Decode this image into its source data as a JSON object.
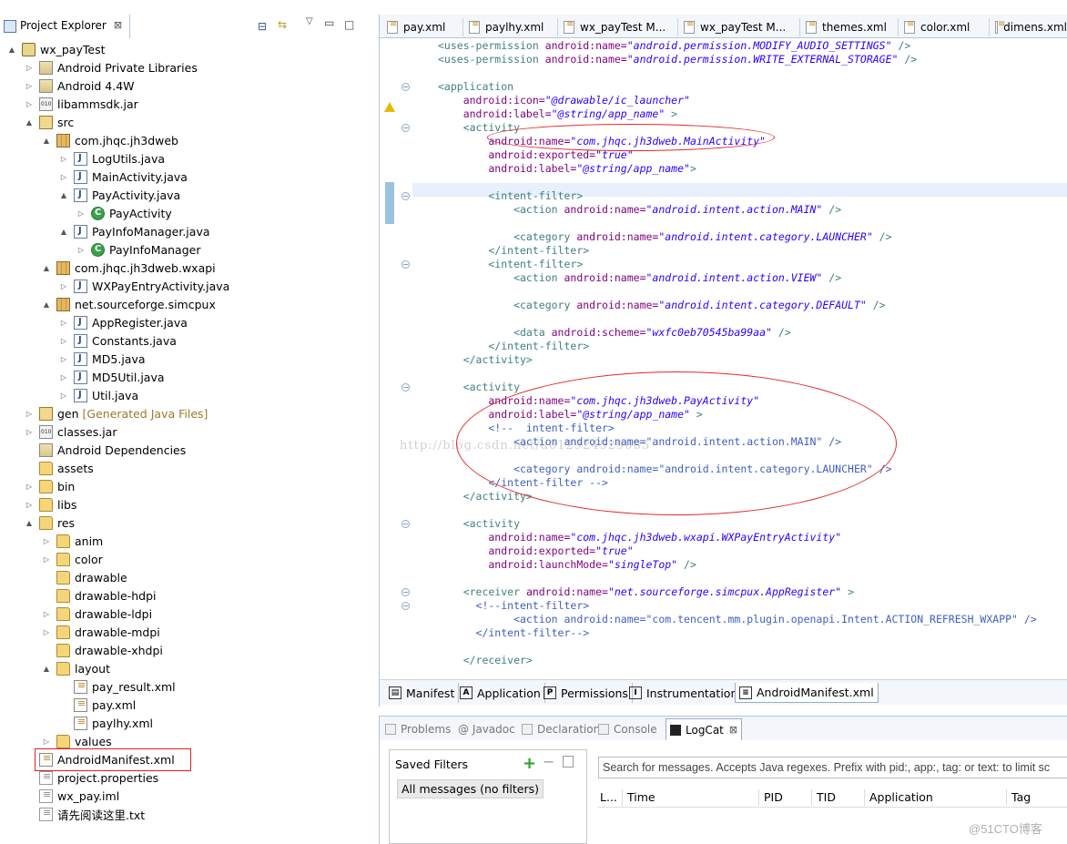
{
  "project_explorer": {
    "tab_title": "Project Explorer",
    "close_glyph": "⊠",
    "tree": [
      {
        "label": "wx_payTest",
        "icon": "project-icon",
        "arrow": "▲",
        "ic": "proj",
        "indent": 0
      },
      {
        "label": "Android Private Libraries",
        "icon": "library-icon",
        "arrow": "▷",
        "ic": "lib",
        "indent": 1
      },
      {
        "label": "Android 4.4W",
        "icon": "library-icon",
        "arrow": "▷",
        "ic": "lib",
        "indent": 1
      },
      {
        "label": "libammsdk.jar",
        "icon": "jar-icon",
        "arrow": "▷",
        "ic": "jar",
        "indent": 1
      },
      {
        "label": "src",
        "icon": "source-folder-icon",
        "arrow": "▲",
        "ic": "src",
        "indent": 1
      },
      {
        "label": "com.jhqc.jh3dweb",
        "icon": "package-icon",
        "arrow": "▲",
        "ic": "pkg",
        "indent": 2
      },
      {
        "label": "LogUtils.java",
        "icon": "java-file-icon",
        "arrow": "▷",
        "ic": "java",
        "indent": 3
      },
      {
        "label": "MainActivity.java",
        "icon": "java-file-icon",
        "arrow": "▷",
        "ic": "java",
        "indent": 3
      },
      {
        "label": "PayActivity.java",
        "icon": "java-file-icon",
        "arrow": "▲",
        "ic": "java",
        "indent": 3
      },
      {
        "label": "PayActivity",
        "icon": "class-icon",
        "arrow": "▷",
        "ic": "cls",
        "indent": 4
      },
      {
        "label": "PayInfoManager.java",
        "icon": "java-file-icon",
        "arrow": "▲",
        "ic": "java",
        "indent": 3
      },
      {
        "label": "PayInfoManager",
        "icon": "class-icon",
        "arrow": "▷",
        "ic": "cls",
        "indent": 4
      },
      {
        "label": "com.jhqc.jh3dweb.wxapi",
        "icon": "package-icon",
        "arrow": "▲",
        "ic": "pkg",
        "indent": 2
      },
      {
        "label": "WXPayEntryActivity.java",
        "icon": "java-file-icon",
        "arrow": "▷",
        "ic": "java",
        "indent": 3
      },
      {
        "label": "net.sourceforge.simcpux",
        "icon": "package-icon",
        "arrow": "▲",
        "ic": "pkg",
        "indent": 2
      },
      {
        "label": "AppRegister.java",
        "icon": "java-file-icon",
        "arrow": "▷",
        "ic": "java",
        "indent": 3
      },
      {
        "label": "Constants.java",
        "icon": "java-file-icon",
        "arrow": "▷",
        "ic": "java",
        "indent": 3
      },
      {
        "label": "MD5.java",
        "icon": "java-file-icon",
        "arrow": "▷",
        "ic": "java",
        "indent": 3
      },
      {
        "label": "MD5Util.java",
        "icon": "java-file-icon",
        "arrow": "▷",
        "ic": "java",
        "indent": 3
      },
      {
        "label": "Util.java",
        "icon": "java-file-icon",
        "arrow": "▷",
        "ic": "java",
        "indent": 3
      },
      {
        "label": "gen",
        "decoration": "[Generated Java Files]",
        "icon": "source-folder-icon",
        "arrow": "▷",
        "ic": "src",
        "indent": 1
      },
      {
        "label": "classes.jar",
        "icon": "jar-icon",
        "arrow": "▷",
        "ic": "jar",
        "indent": 1
      },
      {
        "label": "Android Dependencies",
        "icon": "library-icon",
        "arrow": "",
        "ic": "lib",
        "indent": 1
      },
      {
        "label": "assets",
        "icon": "folder-icon",
        "arrow": "",
        "ic": "folder",
        "indent": 1
      },
      {
        "label": "bin",
        "icon": "folder-icon",
        "arrow": "▷",
        "ic": "folder",
        "indent": 1
      },
      {
        "label": "libs",
        "icon": "folder-icon",
        "arrow": "▷",
        "ic": "folder",
        "indent": 1
      },
      {
        "label": "res",
        "icon": "folder-icon",
        "arrow": "▲",
        "ic": "folder",
        "indent": 1
      },
      {
        "label": "anim",
        "icon": "folder-icon",
        "arrow": "▷",
        "ic": "folder",
        "indent": 2
      },
      {
        "label": "color",
        "icon": "folder-icon",
        "arrow": "▷",
        "ic": "folder",
        "indent": 2
      },
      {
        "label": "drawable",
        "icon": "folder-icon",
        "arrow": "",
        "ic": "folder",
        "indent": 2
      },
      {
        "label": "drawable-hdpi",
        "icon": "folder-icon",
        "arrow": "",
        "ic": "folder",
        "indent": 2
      },
      {
        "label": "drawable-ldpi",
        "icon": "folder-icon",
        "arrow": "▷",
        "ic": "folder",
        "indent": 2
      },
      {
        "label": "drawable-mdpi",
        "icon": "folder-icon",
        "arrow": "▷",
        "ic": "folder",
        "indent": 2
      },
      {
        "label": "drawable-xhdpi",
        "icon": "folder-icon",
        "arrow": "",
        "ic": "folder",
        "indent": 2
      },
      {
        "label": "layout",
        "icon": "folder-icon",
        "arrow": "▲",
        "ic": "folder",
        "indent": 2
      },
      {
        "label": "pay_result.xml",
        "icon": "xml-file-icon",
        "arrow": "",
        "ic": "xml",
        "indent": 3
      },
      {
        "label": "pay.xml",
        "icon": "xml-file-icon",
        "arrow": "",
        "ic": "xml",
        "indent": 3
      },
      {
        "label": "paylhy.xml",
        "icon": "xml-file-icon",
        "arrow": "",
        "ic": "xml",
        "indent": 3
      },
      {
        "label": "values",
        "icon": "folder-icon",
        "arrow": "▷",
        "ic": "folder",
        "indent": 2
      },
      {
        "label": "AndroidManifest.xml",
        "icon": "xml-file-icon",
        "arrow": "",
        "ic": "xml",
        "indent": 1
      },
      {
        "label": "project.properties",
        "icon": "file-icon",
        "arrow": "",
        "ic": "file",
        "indent": 1
      },
      {
        "label": "wx_pay.iml",
        "icon": "file-icon",
        "arrow": "",
        "ic": "file",
        "indent": 1
      },
      {
        "label": "请先阅读这里.txt",
        "icon": "file-icon",
        "arrow": "",
        "ic": "file",
        "indent": 1
      }
    ]
  },
  "editor": {
    "tabs": [
      "pay.xml",
      "paylhy.xml",
      "wx_payTest M...",
      "wx_payTest M...",
      "themes.xml",
      "color.xml",
      "dimens.xml"
    ],
    "watermark": "http://blog.csdn.net/u012924529085",
    "code_lines": [
      [
        [
          "t",
          "<uses-permission "
        ],
        [
          "a",
          "android:name="
        ],
        [
          "v",
          "\"android.permission.MODIFY_AUDIO_SETTINGS\""
        ],
        [
          "t",
          " />"
        ]
      ],
      [
        [
          "t",
          "<uses-permission "
        ],
        [
          "a",
          "android:name="
        ],
        [
          "v",
          "\"android.permission.WRITE_EXTERNAL_STORAGE\""
        ],
        [
          "t",
          " />"
        ]
      ],
      [],
      [
        [
          "t",
          "<application"
        ]
      ],
      [
        [
          "a",
          "    android:icon="
        ],
        [
          "v",
          "\"@drawable/ic_launcher\""
        ]
      ],
      [
        [
          "a",
          "    android:label="
        ],
        [
          "v",
          "\"@string/app_name\""
        ],
        [
          "t",
          " >"
        ]
      ],
      [
        [
          "t",
          "    <activity"
        ]
      ],
      [
        [
          "a",
          "        android:name="
        ],
        [
          "v",
          "\"com.jhqc.jh3dweb.MainActivity\""
        ]
      ],
      [
        [
          "a",
          "        android:exported="
        ],
        [
          "v",
          "\"true\""
        ]
      ],
      [
        [
          "a",
          "        android:label="
        ],
        [
          "v",
          "\"@string/app_name\""
        ],
        [
          "t",
          ">"
        ]
      ],
      [],
      [
        [
          "t",
          "        <intent-filter>"
        ]
      ],
      [
        [
          "t",
          "            <action "
        ],
        [
          "a",
          "android:name="
        ],
        [
          "v",
          "\"android.intent.action.MAIN\""
        ],
        [
          "t",
          " />"
        ]
      ],
      [],
      [
        [
          "t",
          "            <category "
        ],
        [
          "a",
          "android:name="
        ],
        [
          "v",
          "\"android.intent.category.LAUNCHER\""
        ],
        [
          "t",
          " />"
        ]
      ],
      [
        [
          "t",
          "        </intent-filter>"
        ]
      ],
      [
        [
          "t",
          "        <intent-filter>"
        ]
      ],
      [
        [
          "t",
          "            <action "
        ],
        [
          "a",
          "android:name="
        ],
        [
          "v",
          "\"android.intent.action.VIEW\""
        ],
        [
          "t",
          " />"
        ]
      ],
      [],
      [
        [
          "t",
          "            <category "
        ],
        [
          "a",
          "android:name="
        ],
        [
          "v",
          "\"android.intent.category.DEFAULT\""
        ],
        [
          "t",
          " />"
        ]
      ],
      [],
      [
        [
          "t",
          "            <data "
        ],
        [
          "a",
          "android:scheme="
        ],
        [
          "v",
          "\"wxfc0eb70545ba99aa\""
        ],
        [
          "t",
          " />"
        ]
      ],
      [
        [
          "t",
          "        </intent-filter>"
        ]
      ],
      [
        [
          "t",
          "    </activity>"
        ]
      ],
      [],
      [
        [
          "t",
          "    <activity"
        ]
      ],
      [
        [
          "a",
          "        android:name="
        ],
        [
          "v",
          "\"com.jhqc.jh3dweb.PayActivity\""
        ]
      ],
      [
        [
          "a",
          "        android:label="
        ],
        [
          "v",
          "\"@string/app_name\""
        ],
        [
          "t",
          " >"
        ]
      ],
      [
        [
          "c",
          "        <!--  intent-filter>"
        ]
      ],
      [
        [
          "c",
          "            <action android:name=\"android.intent.action.MAIN\" />"
        ]
      ],
      [],
      [
        [
          "c",
          "            <category android:name=\"android.intent.category.LAUNCHER\" />"
        ]
      ],
      [
        [
          "c",
          "        </intent-filter -->"
        ]
      ],
      [
        [
          "t",
          "    </activity>"
        ]
      ],
      [],
      [
        [
          "t",
          "    <activity"
        ]
      ],
      [
        [
          "a",
          "        android:name="
        ],
        [
          "v",
          "\"com.jhqc.jh3dweb.wxapi.WXPayEntryActivity\""
        ]
      ],
      [
        [
          "a",
          "        android:exported="
        ],
        [
          "v",
          "\"true\""
        ]
      ],
      [
        [
          "a",
          "        android:launchMode="
        ],
        [
          "v",
          "\"singleTop\""
        ],
        [
          "t",
          " />"
        ]
      ],
      [],
      [
        [
          "t",
          "    <receiver "
        ],
        [
          "a",
          "android:name="
        ],
        [
          "v",
          "\"net.sourceforge.simcpux.AppRegister\""
        ],
        [
          "t",
          " >"
        ]
      ],
      [
        [
          "c",
          "      <!--intent-filter>"
        ]
      ],
      [
        [
          "c",
          "            <action android:name=\"com.tencent.mm.plugin.openapi.Intent.ACTION_REFRESH_WXAPP\" />"
        ]
      ],
      [
        [
          "c",
          "      </intent-filter-->"
        ]
      ],
      [],
      [
        [
          "t",
          "    </receiver>"
        ]
      ]
    ],
    "page_tabs": [
      {
        "label": "Manifest",
        "glyph": "▤"
      },
      {
        "label": "Application",
        "glyph": "A"
      },
      {
        "label": "Permissions",
        "glyph": "P"
      },
      {
        "label": "Instrumentation",
        "glyph": "I"
      },
      {
        "label": "AndroidManifest.xml",
        "glyph": "≡"
      }
    ]
  },
  "bottom": {
    "tabs": [
      "Problems",
      "@ Javadoc",
      "Declaration",
      "Console",
      "LogCat"
    ],
    "active_tab": "LogCat",
    "saved_filters_title": "Saved Filters",
    "all_messages": "All messages (no filters)",
    "search_placeholder": "Search for messages. Accepts Java regexes. Prefix with pid:, app:, tag: or text: to limit sc",
    "columns": [
      "L...",
      "Time",
      "PID",
      "TID",
      "Application",
      "Tag"
    ],
    "corner_mark": "@51CTO博客"
  }
}
